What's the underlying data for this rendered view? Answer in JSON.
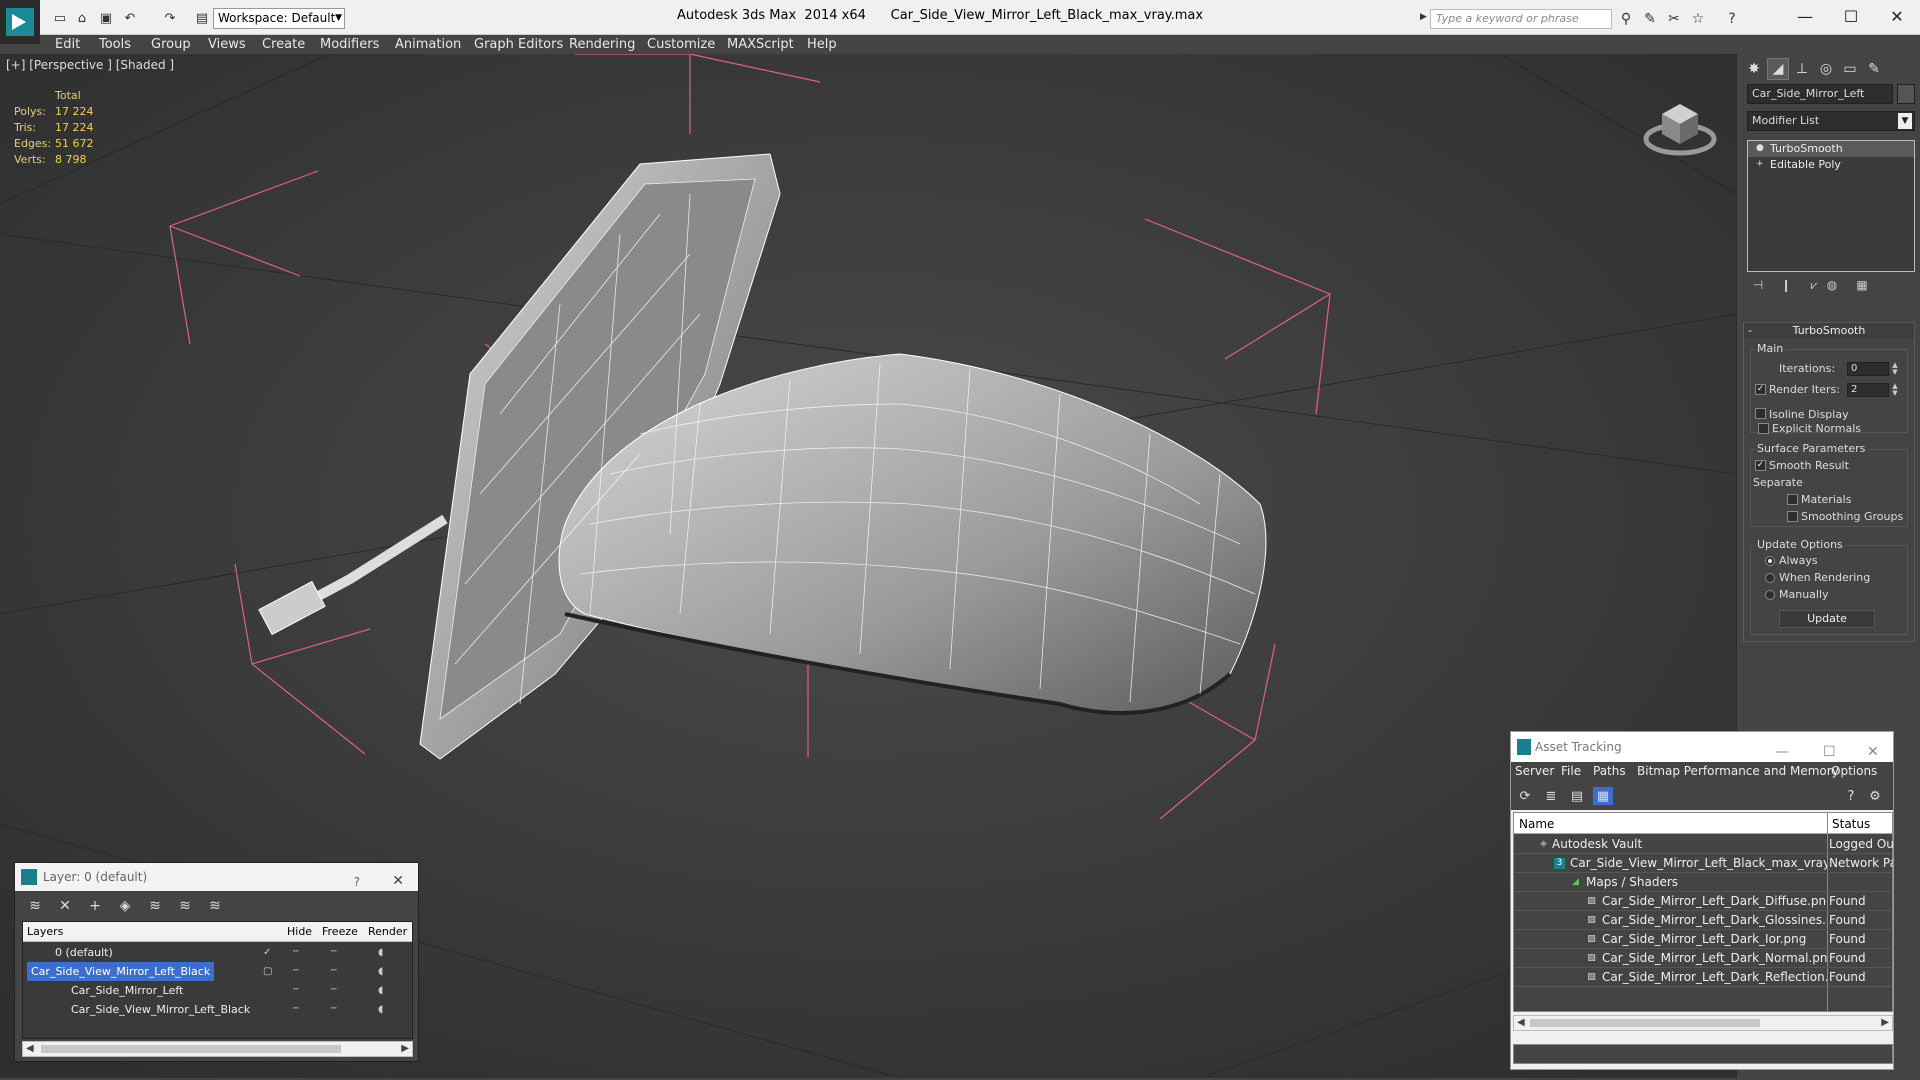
{
  "titlebar": {
    "workspace": "Workspace: Default",
    "title": "Autodesk 3ds Max  2014 x64      Car_Side_View_Mirror_Left_Black_max_vray.max",
    "search_placeholder": "Type a keyword or phrase"
  },
  "menu": [
    "Edit",
    "Tools",
    "Group",
    "Views",
    "Create",
    "Modifiers",
    "Animation",
    "Graph Editors",
    "Rendering",
    "Customize",
    "MAXScript",
    "Help"
  ],
  "viewport": {
    "label": "[+] [Perspective ] [Shaded ]",
    "stats": {
      "header": "Total",
      "polys_label": "Polys:",
      "polys": "17 224",
      "tris_label": "Tris:",
      "tris": "17 224",
      "edges_label": "Edges:",
      "edges": "51 672",
      "verts_label": "Verts:",
      "verts": "8 798"
    }
  },
  "command_panel": {
    "object_name": "Car_Side_Mirror_Left",
    "modifier_list": "Modifier List",
    "stack": [
      "TurboSmooth",
      "Editable Poly"
    ],
    "turbosmooth": {
      "title": "TurboSmooth",
      "main": "Main",
      "iterations_label": "Iterations:",
      "iterations": "0",
      "render_iters_label": "Render Iters:",
      "render_iters": "2",
      "isoline": "Isoline Display",
      "explicit_normals": "Explicit Normals",
      "surface_params": "Surface Parameters",
      "smooth_result": "Smooth Result",
      "separate": "Separate",
      "materials": "Materials",
      "smoothing_groups": "Smoothing Groups",
      "update_options": "Update Options",
      "always": "Always",
      "when_rendering": "When Rendering",
      "manually": "Manually",
      "update_btn": "Update"
    }
  },
  "layer_dialog": {
    "title": "Layer: 0 (default)",
    "help": "?",
    "columns": {
      "layers": "Layers",
      "hide": "Hide",
      "freeze": "Freeze",
      "render": "Render"
    },
    "rows": [
      {
        "name": "0 (default)"
      },
      {
        "name": "Car_Side_View_Mirror_Left_Black"
      },
      {
        "name": "Car_Side_Mirror_Left"
      },
      {
        "name": "Car_Side_View_Mirror_Left_Black"
      }
    ]
  },
  "asset_tracking": {
    "title": "Asset Tracking",
    "menu": [
      "Server",
      "File",
      "Paths",
      "Bitmap Performance and Memory",
      "Options"
    ],
    "columns": {
      "name": "Name",
      "status": "Status"
    },
    "rows": [
      {
        "name": "Autodesk Vault",
        "status": "Logged Ou"
      },
      {
        "name": "Car_Side_View_Mirror_Left_Black_max_vray.max",
        "status": "Network Pa"
      },
      {
        "name": "Maps / Shaders",
        "status": ""
      },
      {
        "name": "Car_Side_Mirror_Left_Dark_Diffuse.png",
        "status": "Found"
      },
      {
        "name": "Car_Side_Mirror_Left_Dark_Glossines.png",
        "status": "Found"
      },
      {
        "name": "Car_Side_Mirror_Left_Dark_Ior.png",
        "status": "Found"
      },
      {
        "name": "Car_Side_Mirror_Left_Dark_Normal.png",
        "status": "Found"
      },
      {
        "name": "Car_Side_Mirror_Left_Dark_Reflection.png",
        "status": "Found"
      }
    ]
  },
  "colors": {
    "viewport_bg": "#3a3a3a",
    "selection": "#3d6ecc",
    "stats_text": "#e0d080",
    "gizmo_lines": "#e06080"
  }
}
